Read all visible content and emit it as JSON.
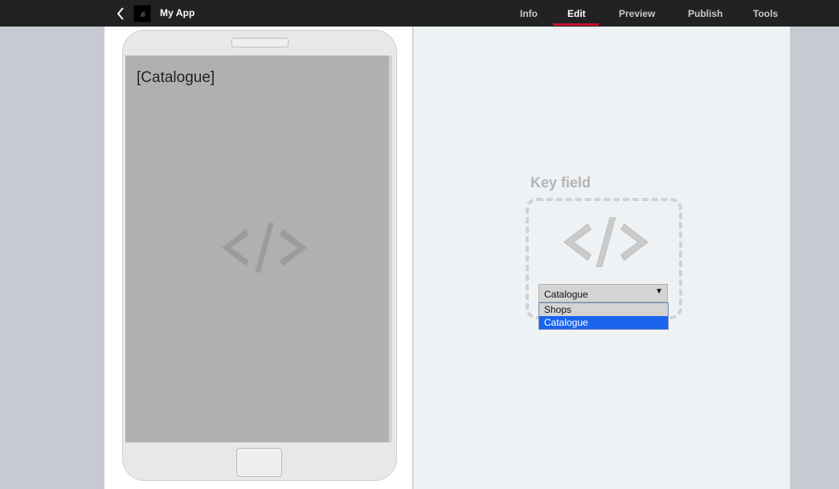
{
  "header": {
    "app_name": "My App",
    "tabs": [
      {
        "label": "Info"
      },
      {
        "label": "Edit"
      },
      {
        "label": "Preview"
      },
      {
        "label": "Publish"
      },
      {
        "label": "Tools"
      }
    ],
    "active_tab": "Edit"
  },
  "phone": {
    "screen_title": "[Catalogue]"
  },
  "editor": {
    "key_field_label": "Key field",
    "select": {
      "value": "Catalogue",
      "options": [
        "Shops",
        "Catalogue"
      ],
      "highlighted_option": "Catalogue"
    }
  },
  "colors": {
    "topbar": "#222222",
    "accent": "#c8102e",
    "highlight": "#1a64f0"
  }
}
